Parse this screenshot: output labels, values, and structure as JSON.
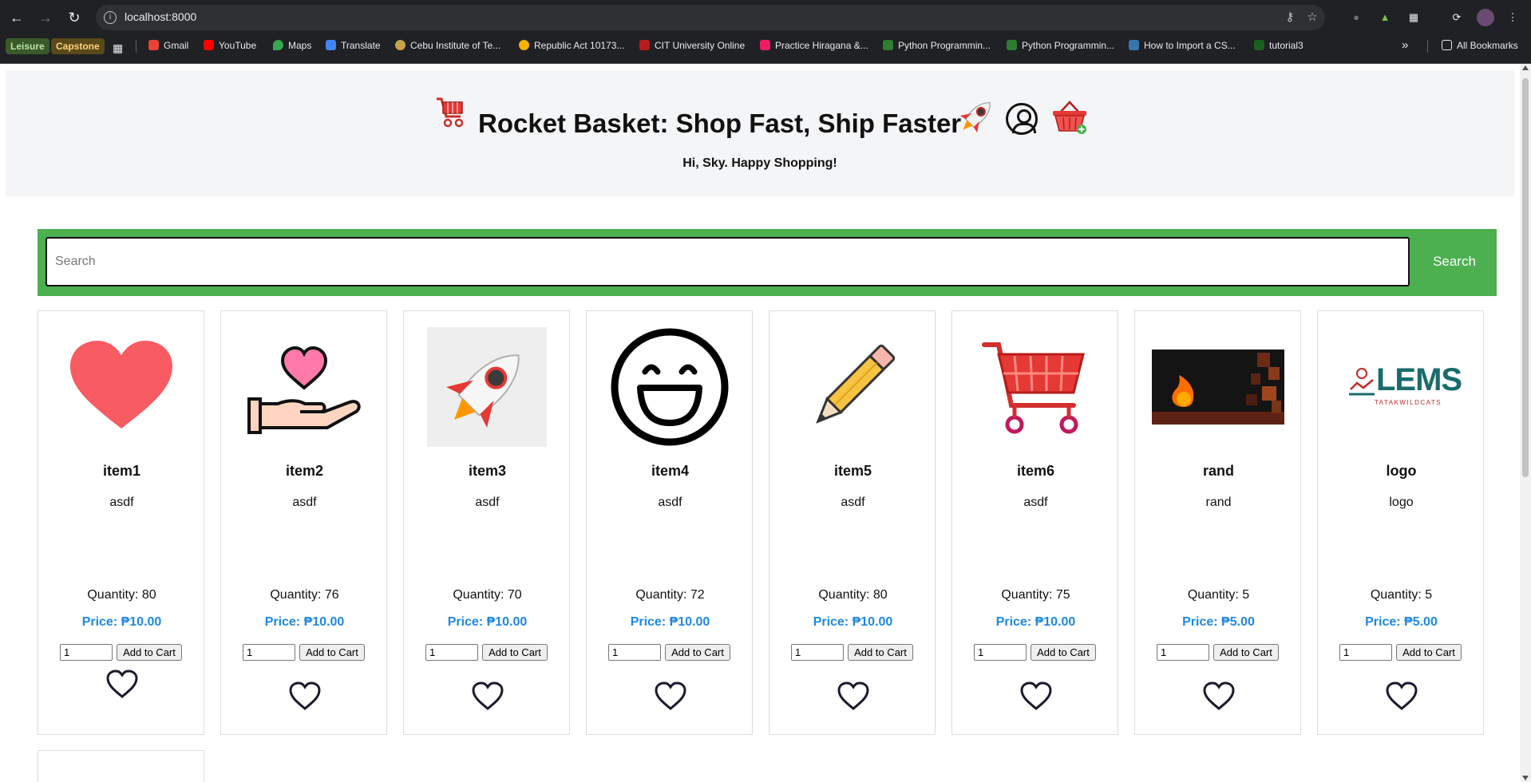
{
  "browser": {
    "url": "localhost:8000",
    "bookmarks": [
      {
        "label": "Leisure",
        "color": "#3a5a2a",
        "text_color": "#b9e2a4",
        "chip": true
      },
      {
        "label": "Capstone",
        "color": "#5a4a1a",
        "text_color": "#ffd27a",
        "chip": true
      },
      {
        "label": "Gmail",
        "icon": "gmail-icon",
        "color": "#ea4335"
      },
      {
        "label": "YouTube",
        "icon": "youtube-icon",
        "color": "#ff0000"
      },
      {
        "label": "Maps",
        "icon": "maps-icon",
        "color": "#34a853"
      },
      {
        "label": "Translate",
        "icon": "translate-icon",
        "color": "#4285f4"
      },
      {
        "label": "Cebu Institute of Te...",
        "icon": "cit-icon",
        "color": "#c8a24a"
      },
      {
        "label": "Republic Act 10173...",
        "icon": "pin-icon",
        "color": "#f4b400"
      },
      {
        "label": "CIT University Online",
        "icon": "cit-online-icon",
        "color": "#b71c1c"
      },
      {
        "label": "Practice Hiragana &...",
        "icon": "hiragana-icon",
        "color": "#e91e63"
      },
      {
        "label": "Python Programmin...",
        "icon": "python-icon",
        "color": "#2e7d32"
      },
      {
        "label": "Python Programmin...",
        "icon": "python-icon",
        "color": "#2e7d32"
      },
      {
        "label": "How to Import a CS...",
        "icon": "py-icon",
        "color": "#3776ab"
      },
      {
        "label": "tutorial3",
        "icon": "tutorial-icon",
        "color": "#1b5e20"
      }
    ],
    "all_bookmarks": "All Bookmarks",
    "more": "»"
  },
  "header": {
    "title": "Rocket Basket: Shop Fast, Ship Faster",
    "greeting": "Hi, Sky. Happy Shopping!"
  },
  "search": {
    "placeholder": "Search",
    "button_label": "Search"
  },
  "products": [
    {
      "name": "item1",
      "description": "asdf",
      "quantity": "Quantity: 80",
      "price": "Price: ₱10.00",
      "qty_value": "1",
      "add_label": "Add to Cart",
      "image": "heart-image"
    },
    {
      "name": "item2",
      "description": "asdf",
      "quantity": "Quantity: 76",
      "price": "Price: ₱10.00",
      "qty_value": "1",
      "add_label": "Add to Cart",
      "image": "hand-heart-image"
    },
    {
      "name": "item3",
      "description": "asdf",
      "quantity": "Quantity: 70",
      "price": "Price: ₱10.00",
      "qty_value": "1",
      "add_label": "Add to Cart",
      "image": "rocket-image"
    },
    {
      "name": "item4",
      "description": "asdf",
      "quantity": "Quantity: 72",
      "price": "Price: ₱10.00",
      "qty_value": "1",
      "add_label": "Add to Cart",
      "image": "smiley-image"
    },
    {
      "name": "item5",
      "description": "asdf",
      "quantity": "Quantity: 80",
      "price": "Price: ₱10.00",
      "qty_value": "1",
      "add_label": "Add to Cart",
      "image": "pencil-image"
    },
    {
      "name": "item6",
      "description": "asdf",
      "quantity": "Quantity: 75",
      "price": "Price: ₱10.00",
      "qty_value": "1",
      "add_label": "Add to Cart",
      "image": "shopping-cart-image"
    },
    {
      "name": "rand",
      "description": "rand",
      "quantity": "Quantity: 5",
      "price": "Price: ₱5.00",
      "qty_value": "1",
      "add_label": "Add to Cart",
      "image": "dark-banner-image"
    },
    {
      "name": "logo",
      "description": "logo",
      "quantity": "Quantity: 5",
      "price": "Price: ₱5.00",
      "qty_value": "1",
      "add_label": "Add to Cart",
      "image": "lems-logo-image",
      "logo_text": "LEMS",
      "logo_subtext": "TATAKWILDCATS"
    }
  ],
  "colors": {
    "accent_green": "#4caf50",
    "price_blue": "#1e88e5",
    "header_bg": "#f4f5f7"
  }
}
